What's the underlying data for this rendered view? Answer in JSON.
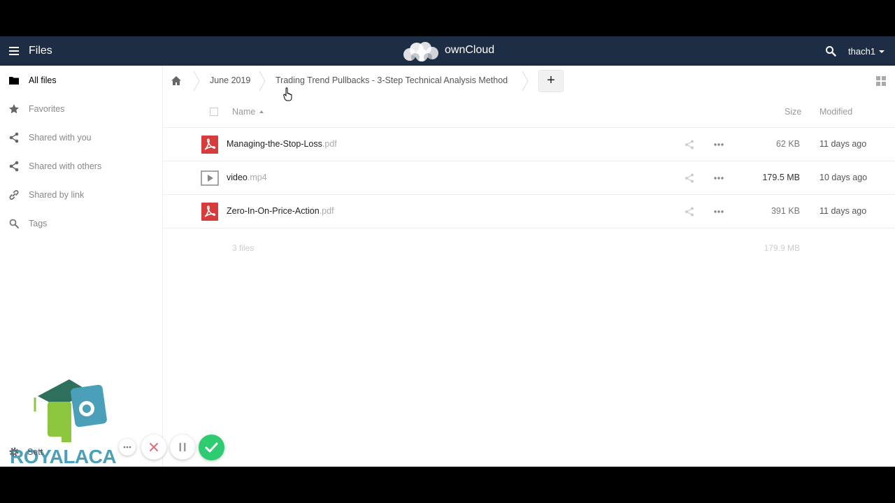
{
  "header": {
    "app_title": "Files",
    "brand": "ownCloud",
    "user": "thach1",
    "colors": {
      "bar": "#1d2d44",
      "text": "#ffffff"
    }
  },
  "sidebar": {
    "items": [
      {
        "label": "All files",
        "icon": "folder-icon",
        "active": true
      },
      {
        "label": "Favorites",
        "icon": "star-icon"
      },
      {
        "label": "Shared with you",
        "icon": "share-icon"
      },
      {
        "label": "Shared with others",
        "icon": "share-icon"
      },
      {
        "label": "Shared by link",
        "icon": "link-icon"
      },
      {
        "label": "Tags",
        "icon": "search-icon"
      }
    ],
    "settings_label": "Sett"
  },
  "watermark": {
    "text": "ROYALACA"
  },
  "breadcrumb": {
    "items": [
      "June 2019",
      "Trading Trend Pullbacks - 3-Step Technical Analysis Method"
    ],
    "new_label": "+"
  },
  "table": {
    "columns": {
      "name": "Name",
      "size": "Size",
      "modified": "Modified"
    },
    "rows": [
      {
        "name": "Managing-the-Stop-Loss",
        "ext": ".pdf",
        "type": "pdf-icon",
        "size": "62 KB",
        "modified": "11 days ago"
      },
      {
        "name": "video",
        "ext": ".mp4",
        "type": "video-icon",
        "size": "179.5 MB",
        "modified": "10 days ago"
      },
      {
        "name": "Zero-In-On-Price-Action",
        "ext": ".pdf",
        "type": "pdf-icon",
        "size": "391 KB",
        "modified": "11 days ago"
      }
    ],
    "summary": {
      "count": "3 files",
      "total": "179.9 MB"
    }
  },
  "player_controls": {
    "more": "more-icon",
    "cancel": "close-icon",
    "pause": "pause-icon",
    "confirm": "check-icon",
    "confirm_color": "#2ecc71",
    "cancel_color": "#e06c75"
  }
}
